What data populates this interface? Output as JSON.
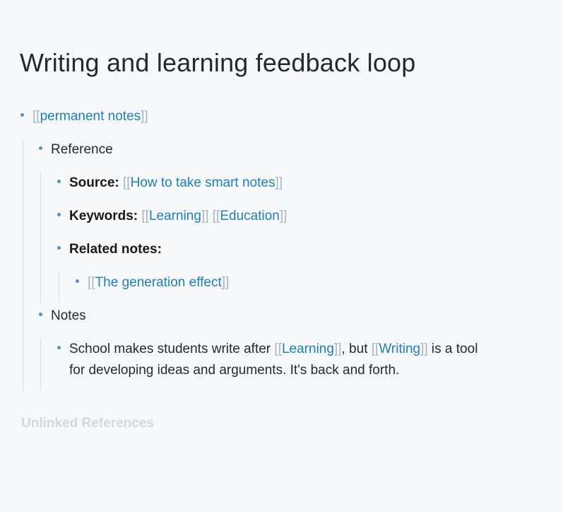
{
  "page": {
    "title": "Writing and learning feedback loop"
  },
  "blocks": {
    "permanent_notes": {
      "open": "[[",
      "link": "permanent notes",
      "close": "]]"
    },
    "reference": {
      "label": "Reference"
    },
    "source": {
      "key": "Source:",
      "open": "[[",
      "link": "How to take smart notes",
      "close": "]]"
    },
    "keywords": {
      "key": "Keywords:",
      "links": [
        {
          "open": "[[",
          "link": "Learning",
          "close": "]]"
        },
        {
          "open": "[[",
          "link": "Education",
          "close": "]]"
        }
      ]
    },
    "related": {
      "key": "Related notes:"
    },
    "generation": {
      "open": "[[",
      "link": "The generation effect",
      "close": "]]"
    },
    "notes": {
      "label": "Notes"
    },
    "school": {
      "before": "School makes students write after ",
      "link1_open": "[[",
      "link1": "Learning",
      "link1_close": "]]",
      "middle": ", but ",
      "link2_open": "[[",
      "link2": "Writing",
      "link2_close": "]]",
      "after1": " is a tool",
      "line2": "for developing ideas and arguments. It's back and forth."
    }
  },
  "unlinked_references": "Unlinked References"
}
